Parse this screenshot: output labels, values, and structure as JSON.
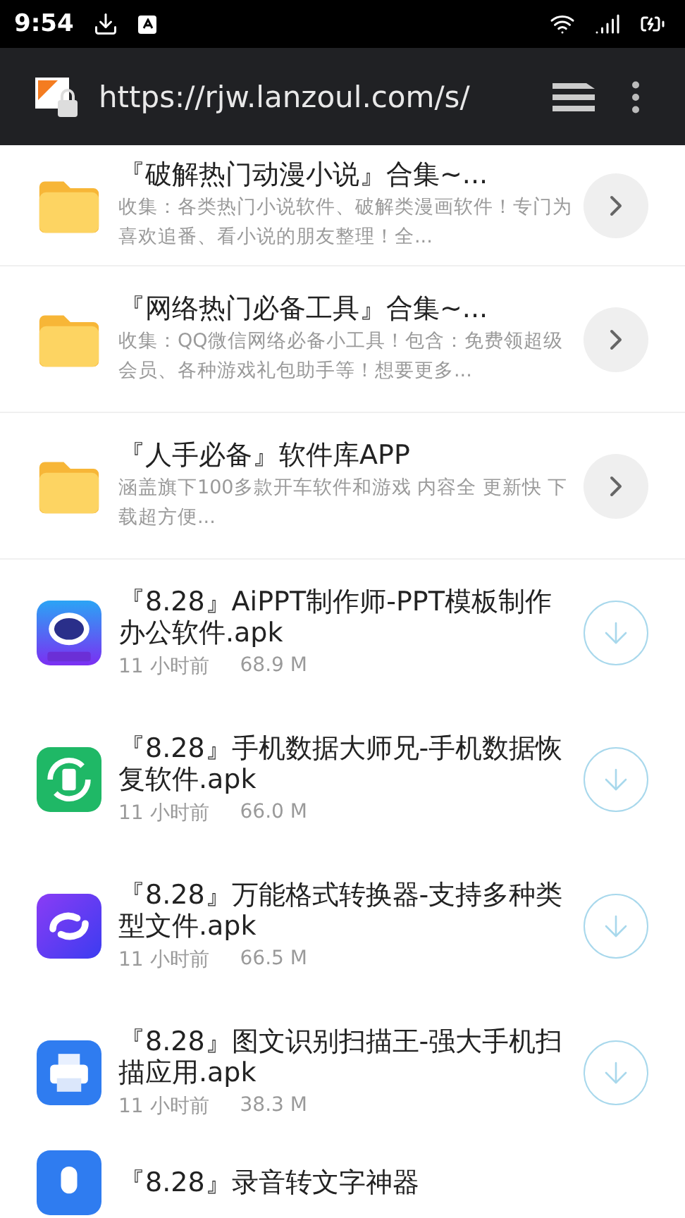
{
  "status_bar": {
    "time": "9:54"
  },
  "address_bar": {
    "url": "https://rjw.lanzoul.com/s/"
  },
  "folders": [
    {
      "title": "『破解热门动漫小说』合集~...",
      "description": "收集：各类热门小说软件、破解类漫画软件！专门为喜欢追番、看小说的朋友整理！全..."
    },
    {
      "title": "『网络热门必备工具』合集~...",
      "description": "收集：QQ微信网络必备小工具！包含：免费领超级会员、各种游戏礼包助手等！想要更多..."
    },
    {
      "title": "『人手必备』软件库APP",
      "description": "涵盖旗下100多款开车软件和游戏 内容全 更新快 下载超方便..."
    }
  ],
  "files": [
    {
      "title": "『8.28』AiPPT制作师-PPT模板制作办公软件.apk",
      "time": "11 小时前",
      "size": "68.9 M"
    },
    {
      "title": "『8.28』手机数据大师兄-手机数据恢复软件.apk",
      "time": "11 小时前",
      "size": "66.0 M"
    },
    {
      "title": "『8.28』万能格式转换器-支持多种类型文件.apk",
      "time": "11 小时前",
      "size": "66.5 M"
    },
    {
      "title": "『8.28』图文识别扫描王-强大手机扫描应用.apk",
      "time": "11 小时前",
      "size": "38.3 M"
    },
    {
      "title": "『8.28』录音转文字神器"
    }
  ]
}
